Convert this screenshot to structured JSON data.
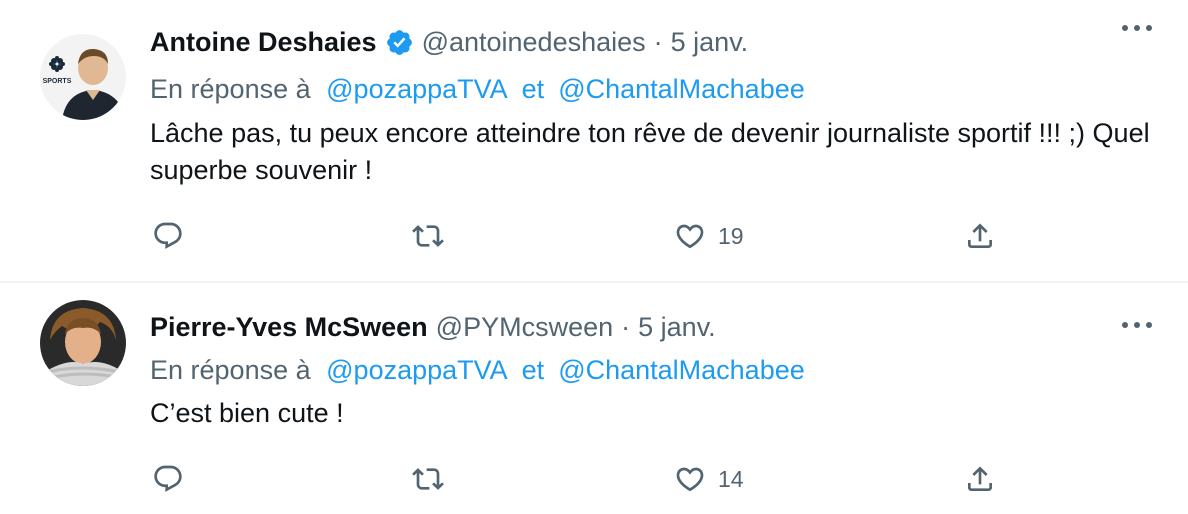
{
  "tweets": [
    {
      "name": "Antoine Deshaies",
      "handle": "@antoinedeshaies",
      "separator": "·",
      "date": "5 janv.",
      "verified": true,
      "reply_prefix": "En réponse à",
      "mentions": [
        "@pozappaTVA",
        "@ChantalMachabee"
      ],
      "mention_joiner": "et",
      "text": "Lâche pas, tu peux encore atteindre ton rêve de devenir journaliste sportif !!! ;) Quel superbe souvenir !",
      "likes": "19",
      "avatar_badge": "SPORTS"
    },
    {
      "name": "Pierre-Yves McSween",
      "handle": "@PYMcsween",
      "separator": "·",
      "date": "5 janv.",
      "verified": false,
      "reply_prefix": "En réponse à",
      "mentions": [
        "@pozappaTVA",
        "@ChantalMachabee"
      ],
      "mention_joiner": "et",
      "text": "C’est bien cute !",
      "likes": "14"
    }
  ],
  "colors": {
    "accent": "#1d9bf0",
    "secondary_text": "#536471",
    "primary_text": "#0f1419",
    "divider": "#eff3f4"
  },
  "icons": [
    "verified-badge-icon",
    "more-options-icon",
    "reply-icon",
    "retweet-icon",
    "like-icon",
    "share-icon"
  ]
}
